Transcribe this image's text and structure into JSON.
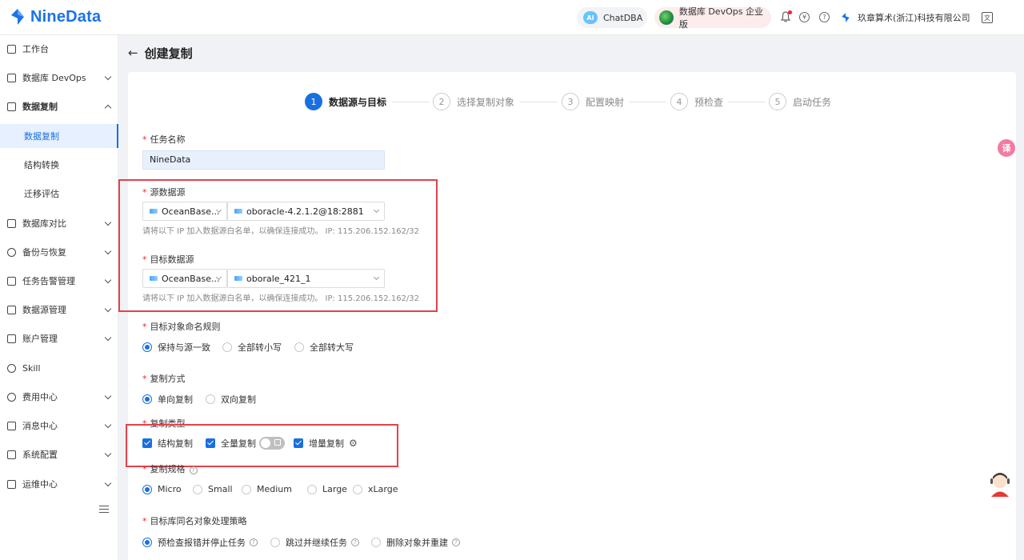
{
  "header": {
    "brand": "NineData",
    "chatdba_label": "ChatDBA",
    "ai_badge": "AI",
    "devops_label": "数据库 DevOps 企业版",
    "org_name": "玖章算术(浙江)科技有限公司",
    "currency_icon": "¥",
    "help_icon": "?",
    "lang_icon": "文"
  },
  "sidebar": {
    "items": [
      {
        "label": "工作台",
        "icon": "home-icon"
      },
      {
        "label": "数据库 DevOps",
        "icon": "monitor-icon"
      },
      {
        "label": "数据复制",
        "icon": "copy-icon"
      },
      {
        "label": "数据复制"
      },
      {
        "label": "结构转换"
      },
      {
        "label": "迁移评估"
      },
      {
        "label": "数据库对比",
        "icon": "compare-icon"
      },
      {
        "label": "备份与恢复",
        "icon": "cloud-icon"
      },
      {
        "label": "任务告警管理",
        "icon": "alarm-icon"
      },
      {
        "label": "数据源管理",
        "icon": "datasource-icon"
      },
      {
        "label": "账户管理",
        "icon": "account-icon"
      },
      {
        "label": "Skill",
        "icon": "skill-icon"
      },
      {
        "label": "费用中心",
        "icon": "yen-icon"
      },
      {
        "label": "消息中心",
        "icon": "mail-icon"
      },
      {
        "label": "系统配置",
        "icon": "grid-icon"
      },
      {
        "label": "运维中心",
        "icon": "wrench-icon"
      }
    ]
  },
  "page": {
    "back_icon": "←",
    "title": "创建复制"
  },
  "steps": [
    {
      "num": "1",
      "label": "数据源与目标"
    },
    {
      "num": "2",
      "label": "选择复制对象"
    },
    {
      "num": "3",
      "label": "配置映射"
    },
    {
      "num": "4",
      "label": "预检查"
    },
    {
      "num": "5",
      "label": "启动任务"
    }
  ],
  "form": {
    "required_mark": "*",
    "task_name_label": "任务名称",
    "task_name_value": "NineData",
    "source_label": "源数据源",
    "source_type": "OceanBase...",
    "source_instance": "oboracle-4.2.1.2@18:2881",
    "source_hint": "请将以下 IP 加入数据源白名单，以确保连接成功。 IP: 115.206.152.162/32",
    "target_label": "目标数据源",
    "target_type": "OceanBase...",
    "target_instance": "oborale_421_1",
    "target_hint": "请将以下 IP 加入数据源白名单，以确保连接成功。 IP: 115.206.152.162/32",
    "naming_label": "目标对象命名规则",
    "naming_options": [
      "保持与源一致",
      "全部转小写",
      "全部转大写"
    ],
    "method_label": "复制方式",
    "method_options": [
      "单向复制",
      "双向复制"
    ],
    "type_label": "复制类型",
    "type_options": [
      "结构复制",
      "全量复制",
      "增量复制"
    ],
    "spec_label": "复制规格",
    "spec_options": [
      "Micro",
      "Small",
      "Medium",
      "Large",
      "xLarge"
    ],
    "conflict_label": "目标库同名对象处理策略",
    "conflict_options": [
      "预检查报错并停止任务",
      "跳过并继续任务",
      "删除对象并重建"
    ],
    "help_mark": "?",
    "gear_icon": "⚙"
  },
  "floating": {
    "translate_icon": "译"
  }
}
